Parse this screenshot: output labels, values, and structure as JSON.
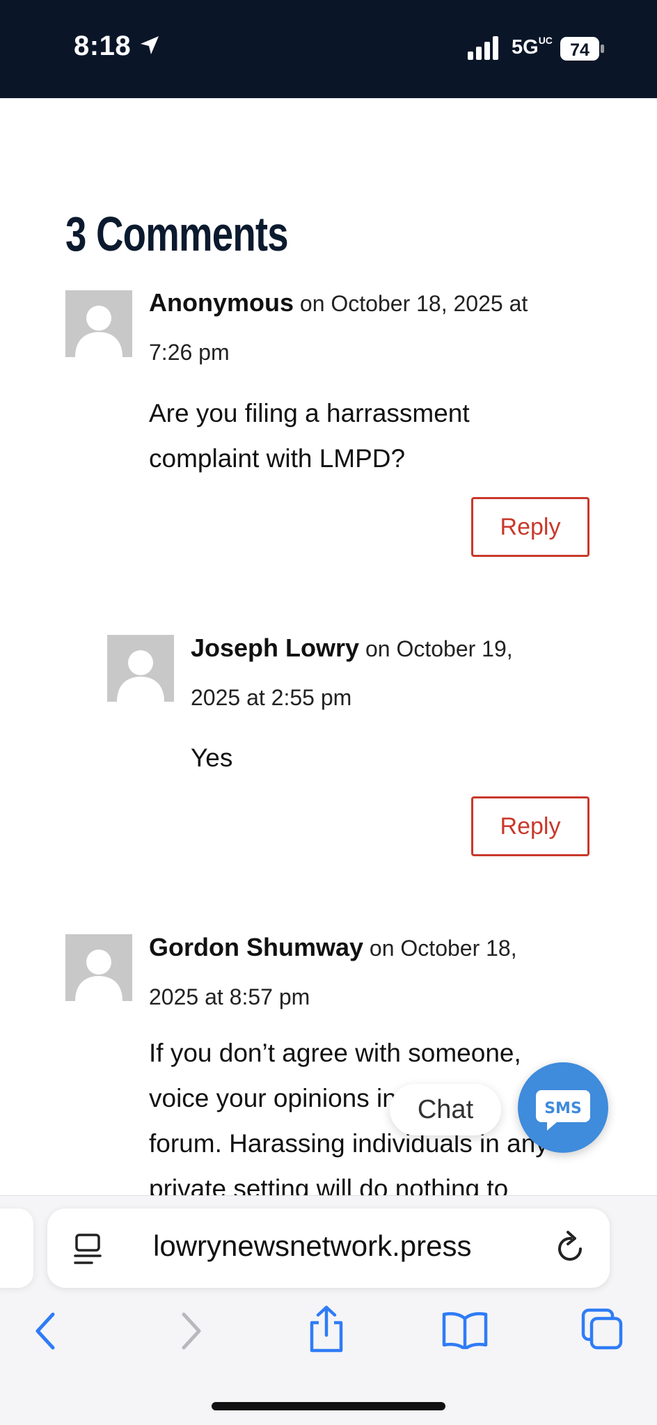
{
  "status_bar": {
    "time": "8:18",
    "network": "5G",
    "network_suffix": "UC",
    "battery": "74"
  },
  "comments_section": {
    "title": "3 Comments",
    "comments": [
      {
        "author": "Anonymous",
        "date_line1": "on October 18, 2025 at",
        "date_line2": "7:26 pm",
        "body_line1": "Are you filing a harrassment",
        "body_line2": "complaint with LMPD?",
        "reply_label": "Reply"
      },
      {
        "author": "Joseph Lowry",
        "date_line1": "on October 19,",
        "date_line2": "2025 at 2:55 pm",
        "body_line1": "Yes",
        "reply_label": "Reply"
      },
      {
        "author": "Gordon Shumway",
        "date_line1": "on October 18,",
        "date_line2": "2025 at 8:57 pm",
        "body_line1": "If you don’t agree with someone,",
        "body_line2": "voice your opinions in a public",
        "body_line3": "forum. Harassing individuals in any",
        "body_line4": "private setting will do nothing to"
      }
    ]
  },
  "chat_widget": {
    "chat_label": "Chat",
    "sms_label": "SMS"
  },
  "browser": {
    "url": "lowrynewsnetwork.press"
  },
  "colors": {
    "status_bar_bg": "#0a1628",
    "heading": "#0b1a2e",
    "reply_accent": "#c8392b",
    "sms_blue": "#3f8bdc",
    "ios_blue": "#2f7cf6"
  }
}
